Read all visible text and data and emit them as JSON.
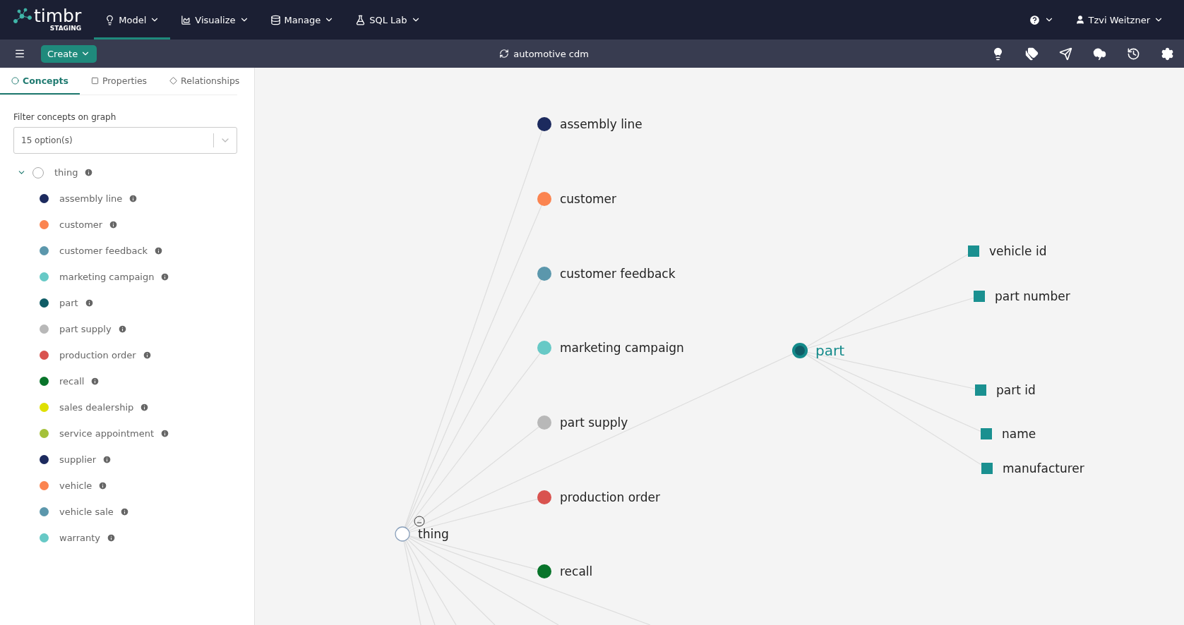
{
  "top_nav": {
    "logo": "timbr",
    "environment": "STAGING",
    "menus": [
      {
        "label": "Model",
        "selected": true
      },
      {
        "label": "Visualize",
        "selected": false
      },
      {
        "label": "Manage",
        "selected": false
      },
      {
        "label": "SQL Lab",
        "selected": false
      }
    ],
    "user": "Tzvi Weitzner"
  },
  "toolbar": {
    "create": "Create",
    "ontology": "automotive cdm"
  },
  "sidebar": {
    "tabs": [
      {
        "label": "Concepts",
        "selected": true
      },
      {
        "label": "Properties",
        "selected": false
      },
      {
        "label": "Relationships",
        "selected": false
      }
    ],
    "filter": {
      "label": "Filter concepts on graph",
      "value": "15 option(s)"
    },
    "tree": {
      "label": "thing",
      "expanded": true,
      "children": [
        {
          "label": "assembly line",
          "color": "#1c2a5e"
        },
        {
          "label": "customer",
          "color": "#fb8450"
        },
        {
          "label": "customer feedback",
          "color": "#5b97ac"
        },
        {
          "label": "marketing campaign",
          "color": "#67c9c6"
        },
        {
          "label": "part",
          "color": "#0f5c66"
        },
        {
          "label": "part supply",
          "color": "#b8b8b8"
        },
        {
          "label": "production order",
          "color": "#d9534f"
        },
        {
          "label": "recall",
          "color": "#08742a"
        },
        {
          "label": "sales dealership",
          "color": "#dfe000"
        },
        {
          "label": "service appointment",
          "color": "#a4c13a"
        },
        {
          "label": "supplier",
          "color": "#1c2a5e"
        },
        {
          "label": "vehicle",
          "color": "#fb8450"
        },
        {
          "label": "vehicle sale",
          "color": "#5b97ac"
        },
        {
          "label": "warranty",
          "color": "#67c9c6"
        }
      ]
    }
  },
  "graph": {
    "root": {
      "label": "thing",
      "expanded": true
    },
    "concepts": [
      {
        "label": "assembly line",
        "color": "#1c2a5e"
      },
      {
        "label": "customer",
        "color": "#fb8450"
      },
      {
        "label": "customer feedback",
        "color": "#5b97ac"
      },
      {
        "label": "marketing campaign",
        "color": "#67c9c6"
      },
      {
        "label": "part supply",
        "color": "#b8b8b8"
      },
      {
        "label": "production order",
        "color": "#d9534f"
      },
      {
        "label": "recall",
        "color": "#08742a"
      }
    ],
    "focus": {
      "label": "part",
      "color": "#138a8a",
      "properties": [
        "vehicle id",
        "part number",
        "part id",
        "name",
        "manufacturer"
      ]
    }
  }
}
